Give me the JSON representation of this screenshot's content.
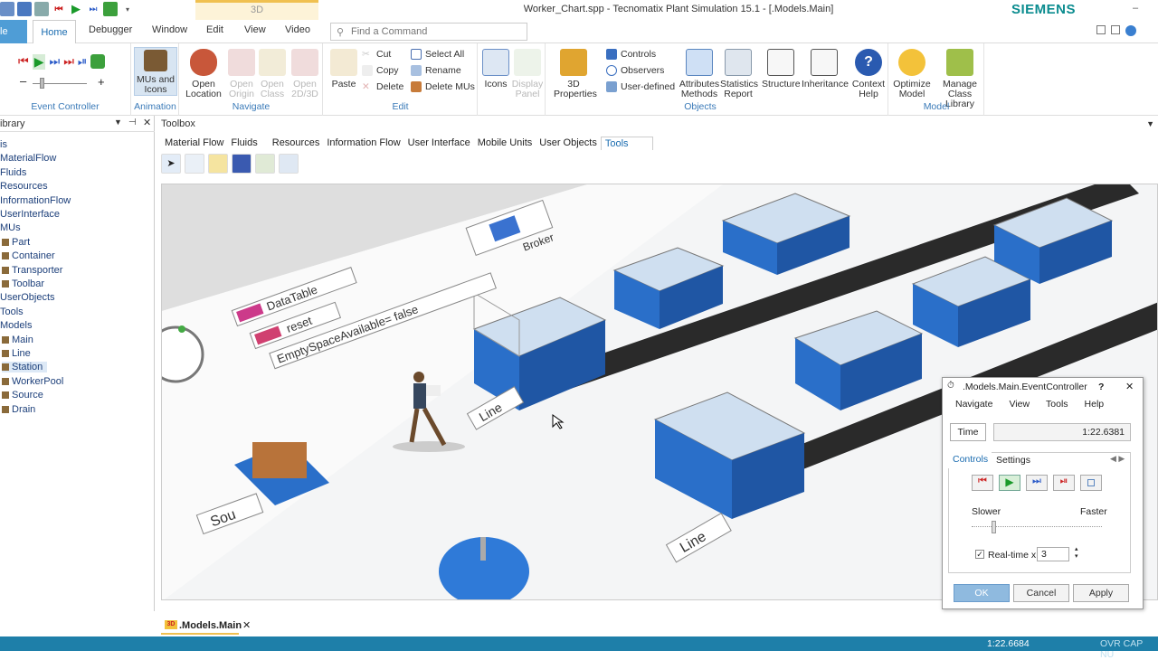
{
  "window": {
    "title": "Worker_Chart.spp - Tecnomatix Plant Simulation 15.1 - [.Models.Main]",
    "context_tab": "3D",
    "brand": "SIEMENS"
  },
  "ribbon_tabs": [
    "Home",
    "Debugger",
    "Window",
    "Edit",
    "View",
    "Video"
  ],
  "file_tab": "le",
  "search": {
    "placeholder": "Find a Command"
  },
  "ribbon": {
    "event_controller": {
      "label": "Event Controller"
    },
    "animation": {
      "label": "Animation",
      "mus_and_icons": "MUs and Icons"
    },
    "navigate": {
      "label": "Navigate",
      "open_location": "Open Location",
      "open_origin": "Open Origin",
      "open_class": "Open Class",
      "open_2d3d": "Open 2D/3D"
    },
    "edit": {
      "label": "Edit",
      "paste": "Paste",
      "cut": "Cut",
      "copy": "Copy",
      "delete": "Delete",
      "select_all": "Select All",
      "rename": "Rename",
      "delete_mus": "Delete MUs"
    },
    "icons": {
      "icons": "Icons",
      "display_panel": "Display Panel"
    },
    "objects": {
      "label": "Objects",
      "props_3d": "3D Properties",
      "controls": "Controls",
      "observers": "Observers",
      "user_defined": "User-defined",
      "attributes_methods": "Attributes Methods",
      "statistics_report": "Statistics Report",
      "structure": "Structure",
      "inheritance": "Inheritance"
    },
    "help": {
      "context_help": "Context Help"
    },
    "model": {
      "label": "Model",
      "optimize_model": "Optimize Model",
      "manage_class_library": "Manage Class Library"
    }
  },
  "library": {
    "title": "ibrary",
    "items": [
      "is",
      "MaterialFlow",
      "Fluids",
      "Resources",
      "InformationFlow",
      "UserInterface",
      "MUs",
      "Part",
      "Container",
      "Transporter",
      "Toolbar",
      "UserObjects",
      "Tools",
      "Models",
      "Main",
      "Line",
      "Station",
      "WorkerPool",
      "Source",
      "Drain"
    ]
  },
  "toolbox": {
    "title": "Toolbox",
    "tabs": [
      "Material Flow",
      "Fluids",
      "Resources",
      "Information Flow",
      "User Interface",
      "Mobile Units",
      "User Objects",
      "Tools"
    ],
    "active_tab": "Tools"
  },
  "scene": {
    "labels": {
      "datatable": "DataTable",
      "reset": "reset",
      "empty_space": "EmptySpaceAvailable=  false",
      "broker": "Broker",
      "line1": "Line",
      "line2": "Line",
      "source": "Sou"
    }
  },
  "event_controller": {
    "title": ".Models.Main.EventController",
    "help": "?",
    "menu": [
      "Navigate",
      "View",
      "Tools",
      "Help"
    ],
    "time_label": "Time",
    "time_value": "1:22.6381",
    "tabs": [
      "Controls",
      "Settings"
    ],
    "slower": "Slower",
    "faster": "Faster",
    "realtime_label": "Real-time x",
    "realtime_value": "3",
    "realtime_checked": true,
    "ok": "OK",
    "cancel": "Cancel",
    "apply": "Apply"
  },
  "doc_tab": {
    "label": ".Models.Main",
    "icon_text": "3D"
  },
  "status": {
    "time": "1:22.6684",
    "flags": "OVR  CAP  NU"
  },
  "colors": {
    "accent": "#1e7fa9",
    "station_blue": "#2a6fc9",
    "brand": "#0b8c8f"
  }
}
